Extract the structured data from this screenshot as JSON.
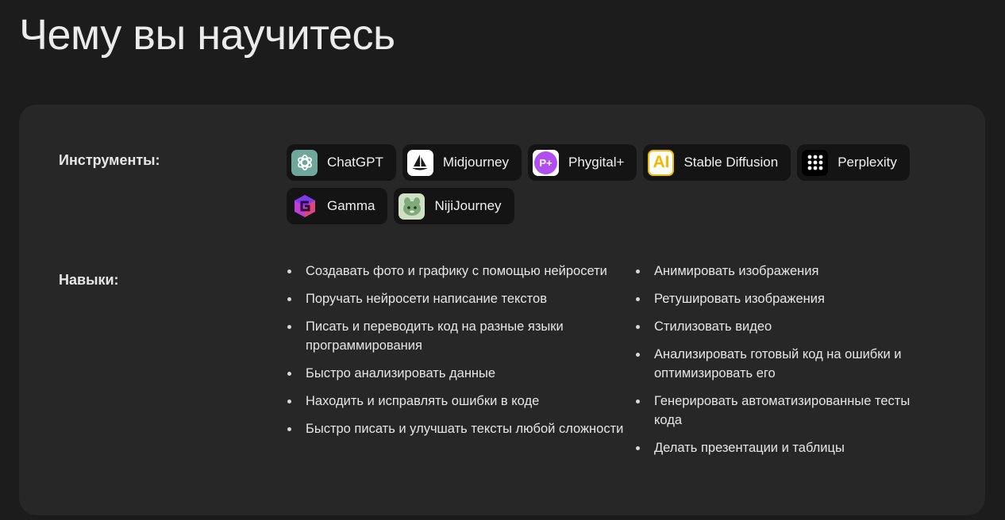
{
  "page": {
    "title": "Чему вы научитесь"
  },
  "tools_section": {
    "label": "Инструменты:",
    "items": [
      {
        "label": "ChatGPT",
        "icon": "chatgpt-icon"
      },
      {
        "label": "Midjourney",
        "icon": "midjourney-icon"
      },
      {
        "label": "Phygital+",
        "icon": "phygital-icon"
      },
      {
        "label": "Stable Diffusion",
        "icon": "stable-diffusion-icon"
      },
      {
        "label": "Perplexity",
        "icon": "perplexity-icon"
      },
      {
        "label": "Gamma",
        "icon": "gamma-icon"
      },
      {
        "label": "NijiJourney",
        "icon": "nijijourney-icon"
      }
    ],
    "icon_texts": {
      "phygital": "P+",
      "stable_diffusion": "AI"
    }
  },
  "skills_section": {
    "label": "Навыки:",
    "left": [
      "Создавать фото и графику с помощью нейросети",
      "Поручать нейросети написание текстов",
      "Писать и переводить код на разные языки программирования",
      "Быстро анализировать данные",
      "Находить и исправлять ошибки в коде",
      "Быстро писать и улучшать тексты любой сложности"
    ],
    "right": [
      "Анимировать изображения",
      "Ретушировать изображения",
      "Стилизовать видео",
      "Анализировать готовый код на ошибки и оптимизировать его",
      "Генерировать автоматизированные тесты кода",
      "Делать презентации и таблицы"
    ]
  },
  "colors": {
    "page_bg": "#1c1c1c",
    "card_bg": "#272727",
    "chip_bg": "#141414",
    "chatgpt": "#6fa89a",
    "phygital": "#b14ef0",
    "stable_diffusion": "#f5b800",
    "gamma": "#c23cd6",
    "nijijourney": "#cfe0c4"
  }
}
